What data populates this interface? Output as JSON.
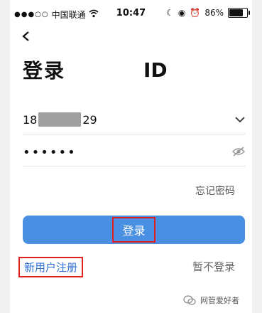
{
  "status_bar": {
    "carrier": "中国联通",
    "time": "10:47",
    "battery_text": "86%",
    "battery_level": 0.86
  },
  "nav": {
    "back_icon": "chevron-left-icon"
  },
  "header": {
    "title": "登录",
    "title_suffix": "ID"
  },
  "form": {
    "account_prefix": "18",
    "account_suffix": "29",
    "password_mask": "••••••",
    "forgot_password": "忘记密码",
    "login_button": "登录"
  },
  "footer": {
    "register": "新用户注册",
    "skip_login": "暂不登录"
  },
  "watermark": {
    "text": "网管爱好者"
  },
  "colors": {
    "accent": "#4a90e2",
    "link": "#2f6fd6",
    "highlight": "#e02020"
  }
}
